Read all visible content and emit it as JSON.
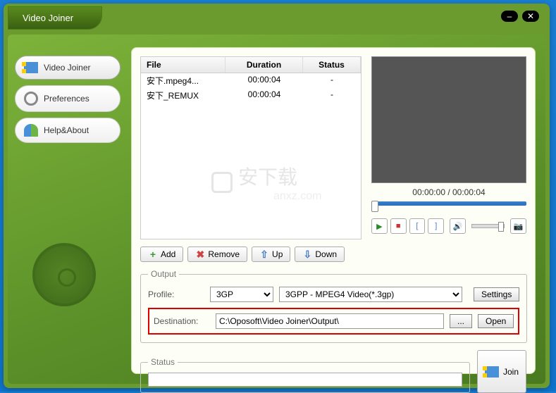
{
  "window": {
    "title": "Video Joiner"
  },
  "sidebar": {
    "items": [
      {
        "label": "Video Joiner"
      },
      {
        "label": "Preferences"
      },
      {
        "label": "Help&About"
      }
    ]
  },
  "filelist": {
    "columns": {
      "file": "File",
      "duration": "Duration",
      "status": "Status"
    },
    "rows": [
      {
        "file": "安下.mpeg4...",
        "duration": "00:00:04",
        "status": "-"
      },
      {
        "file": "安下_REMUX",
        "duration": "00:00:04",
        "status": "-"
      }
    ]
  },
  "preview": {
    "time": "00:00:00 / 00:00:04"
  },
  "toolbar": {
    "add": "Add",
    "remove": "Remove",
    "up": "Up",
    "down": "Down"
  },
  "output": {
    "legend": "Output",
    "profile_label": "Profile:",
    "profile_format": "3GP",
    "profile_detail": "3GPP - MPEG4 Video(*.3gp)",
    "settings_btn": "Settings",
    "dest_label": "Destination:",
    "dest_value": "C:\\Oposoft\\Video Joiner\\Output\\",
    "browse_btn": "...",
    "open_btn": "Open"
  },
  "status": {
    "legend": "Status"
  },
  "join_btn": "Join",
  "watermark": {
    "text": "安下载",
    "sub": "anxz.com"
  }
}
